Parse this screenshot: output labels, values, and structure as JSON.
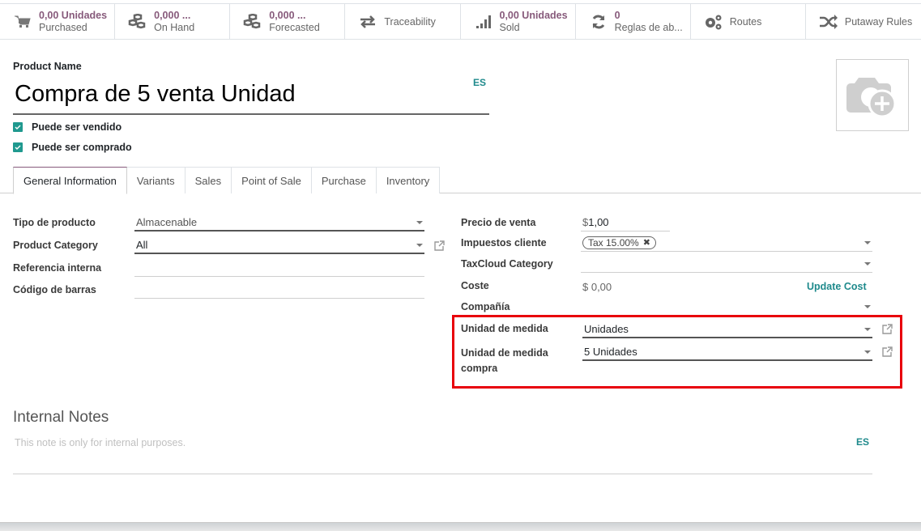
{
  "smart_buttons": [
    {
      "icon": "cart-icon",
      "value": "0,00 Unidades",
      "label": "Purchased"
    },
    {
      "icon": "cubes-icon",
      "value": "0,000 ...",
      "label": "On Hand"
    },
    {
      "icon": "cubes-icon",
      "value": "0,000 ...",
      "label": "Forecasted"
    },
    {
      "icon": "exchange-icon",
      "label": "Traceability"
    },
    {
      "icon": "signal-icon",
      "value": "0,00 Unidades",
      "label": "Sold"
    },
    {
      "icon": "refresh-icon",
      "value": "0",
      "label": "Reglas de ab..."
    },
    {
      "icon": "cogs-icon",
      "label": "Routes"
    },
    {
      "icon": "random-icon",
      "label": "Putaway Rules"
    }
  ],
  "product": {
    "name_label": "Product Name",
    "name": "Compra de 5 venta Unidad",
    "lang": "ES",
    "can_be_sold_label": "Puede ser vendido",
    "can_be_sold": true,
    "can_be_purchased_label": "Puede ser comprado",
    "can_be_purchased": true
  },
  "tabs": [
    {
      "label": "General Information",
      "active": true
    },
    {
      "label": "Variants"
    },
    {
      "label": "Sales"
    },
    {
      "label": "Point of Sale"
    },
    {
      "label": "Purchase"
    },
    {
      "label": "Inventory"
    }
  ],
  "left_fields": {
    "product_type": {
      "label": "Tipo de producto",
      "value": "Almacenable"
    },
    "category": {
      "label": "Product Category",
      "value": "All"
    },
    "internal_ref": {
      "label": "Referencia interna",
      "value": ""
    },
    "barcode": {
      "label": "Código de barras",
      "value": ""
    }
  },
  "right_fields": {
    "sale_price": {
      "label": "Precio de venta",
      "currency": "$",
      "value": "1,00"
    },
    "customer_taxes": {
      "label": "Impuestos cliente",
      "tags": [
        "Tax 15.00%"
      ]
    },
    "taxcloud": {
      "label": "TaxCloud Category",
      "value": ""
    },
    "cost": {
      "label": "Coste",
      "value": "$ 0,00",
      "action": "Update Cost"
    },
    "company": {
      "label": "Compañía",
      "value": ""
    },
    "uom": {
      "label": "Unidad de medida",
      "value": "Unidades"
    },
    "uom_po": {
      "label": "Unidad de medida compra",
      "value": "5 Unidades"
    }
  },
  "notes": {
    "title": "Internal Notes",
    "placeholder": "This note is only for internal purposes.",
    "lang": "ES"
  },
  "colors": {
    "primary": "#875a7b",
    "teal": "#1f8a8c",
    "checkbox": "#20998f",
    "highlight": "#e8000b"
  }
}
